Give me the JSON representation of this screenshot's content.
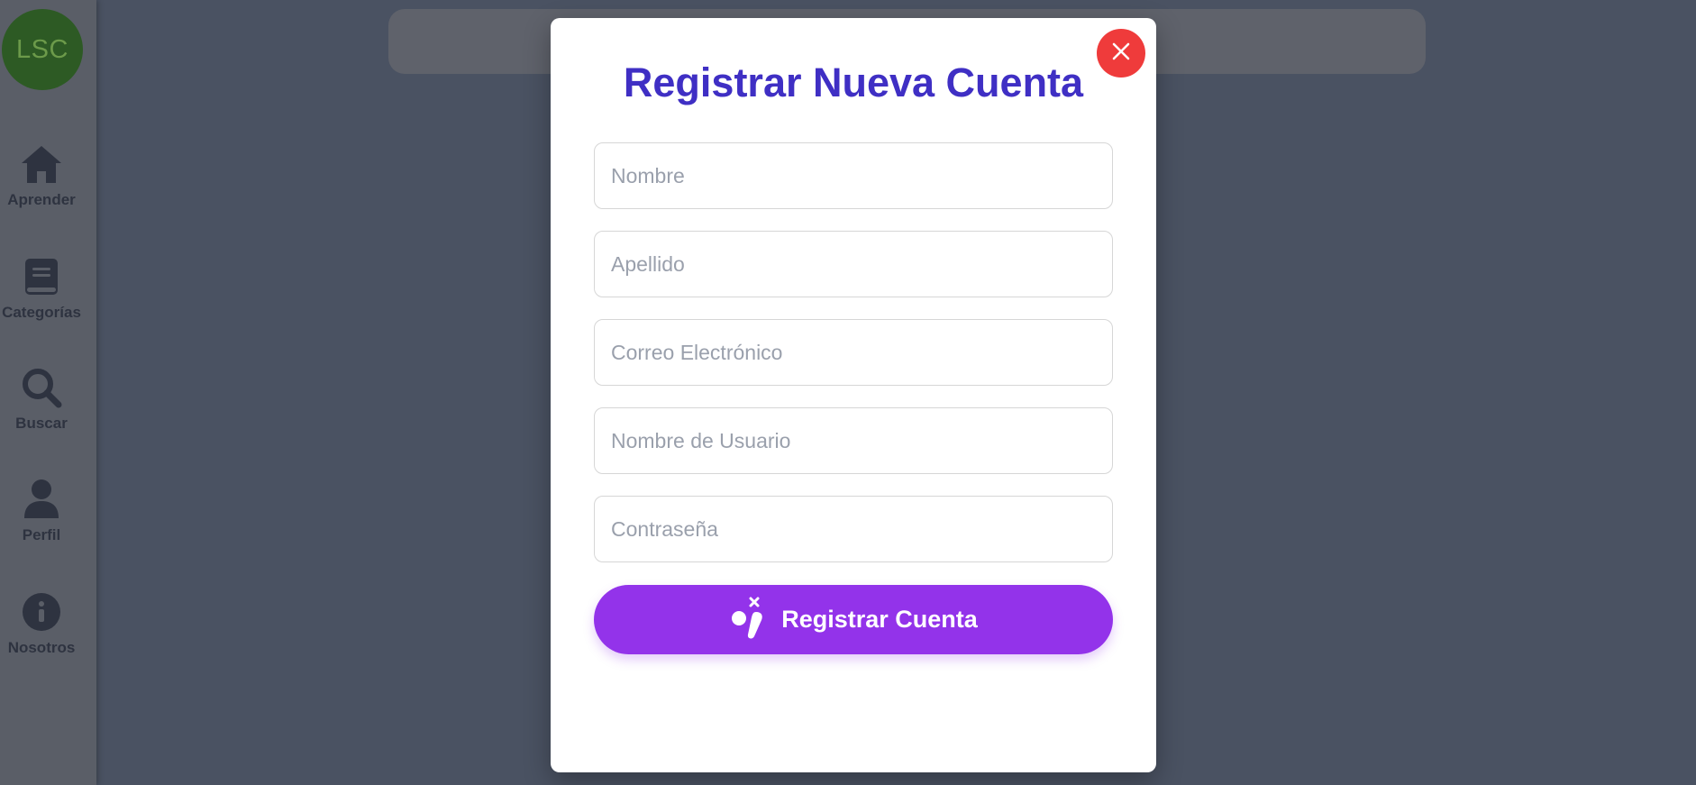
{
  "sidebar": {
    "logo_text": "LSC",
    "items": [
      {
        "label": "Aprender",
        "icon": "home-icon"
      },
      {
        "label": "Categorías",
        "icon": "book-icon"
      },
      {
        "label": "Buscar",
        "icon": "search-icon"
      },
      {
        "label": "Perfil",
        "icon": "user-icon"
      },
      {
        "label": "Nosotros",
        "icon": "info-icon"
      }
    ]
  },
  "modal": {
    "title": "Registrar Nueva Cuenta",
    "fields": {
      "first_name": {
        "placeholder": "Nombre",
        "value": ""
      },
      "last_name": {
        "placeholder": "Apellido",
        "value": ""
      },
      "email": {
        "placeholder": "Correo Electrónico",
        "value": ""
      },
      "username": {
        "placeholder": "Nombre de Usuario",
        "value": ""
      },
      "password": {
        "placeholder": "Contraseña",
        "value": ""
      }
    },
    "submit_label": "Registrar Cuenta",
    "submit_icon": "sign-language-icon",
    "close_icon": "close-icon"
  },
  "colors": {
    "title": "#3f2fc4",
    "submit": "#9333ea",
    "close": "#ef3b3b",
    "overlay": "#4a5262",
    "logo": "#2d5a24"
  }
}
